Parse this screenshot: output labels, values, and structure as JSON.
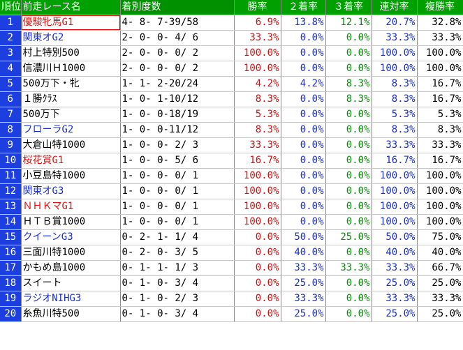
{
  "headers": {
    "rank": "順位",
    "race": "前走レース名",
    "record": "着別度数",
    "win": "勝率",
    "second": "２着率",
    "third": "３着率",
    "rentai": "連対率",
    "fukusho": "複勝率"
  },
  "colors": {
    "header_bg": "#00a000",
    "rank_bg": "#1d3fe0",
    "win_text": "#cc1111",
    "second_text": "#1a2fcc",
    "third_text": "#0a8a0a",
    "g1_text": "#e01010",
    "g2g3_text": "#1a2fcc"
  },
  "rows": [
    {
      "rank": "1",
      "race": "優駿牝馬G1",
      "race_color": "#e01010",
      "boxed": true,
      "record": "4- 8- 7-39/58",
      "win": "6.9%",
      "second": "13.8%",
      "third": "12.1%",
      "rentai": "20.7%",
      "fukusho": "32.8%"
    },
    {
      "rank": "2",
      "race": "関東オG2",
      "race_color": "#1a2fcc",
      "boxed": false,
      "record": "2- 0- 0- 4/ 6",
      "win": "33.3%",
      "second": "0.0%",
      "third": "0.0%",
      "rentai": "33.3%",
      "fukusho": "33.3%"
    },
    {
      "rank": "3",
      "race": "村上特別500",
      "race_color": "#000000",
      "boxed": false,
      "record": "2- 0- 0- 0/ 2",
      "win": "100.0%",
      "second": "0.0%",
      "third": "0.0%",
      "rentai": "100.0%",
      "fukusho": "100.0%"
    },
    {
      "rank": "4",
      "race": "信濃川Ｈ1000",
      "race_color": "#000000",
      "boxed": false,
      "record": "2- 0- 0- 0/ 2",
      "win": "100.0%",
      "second": "0.0%",
      "third": "0.0%",
      "rentai": "100.0%",
      "fukusho": "100.0%"
    },
    {
      "rank": "5",
      "race": "500万下・牝",
      "race_color": "#000000",
      "boxed": false,
      "record": "1- 1- 2-20/24",
      "win": "4.2%",
      "second": "4.2%",
      "third": "8.3%",
      "rentai": "8.3%",
      "fukusho": "16.7%"
    },
    {
      "rank": "6",
      "race": "１勝ｸﾗｽ",
      "race_color": "#000000",
      "boxed": false,
      "record": "1- 0- 1-10/12",
      "win": "8.3%",
      "second": "0.0%",
      "third": "8.3%",
      "rentai": "8.3%",
      "fukusho": "16.7%"
    },
    {
      "rank": "7",
      "race": "500万下",
      "race_color": "#000000",
      "boxed": false,
      "record": "1- 0- 0-18/19",
      "win": "5.3%",
      "second": "0.0%",
      "third": "0.0%",
      "rentai": "5.3%",
      "fukusho": "5.3%"
    },
    {
      "rank": "8",
      "race": "フローラG2",
      "race_color": "#1a2fcc",
      "boxed": false,
      "record": "1- 0- 0-11/12",
      "win": "8.3%",
      "second": "0.0%",
      "third": "0.0%",
      "rentai": "8.3%",
      "fukusho": "8.3%"
    },
    {
      "rank": "9",
      "race": "大倉山特1000",
      "race_color": "#000000",
      "boxed": false,
      "record": "1- 0- 0- 2/ 3",
      "win": "33.3%",
      "second": "0.0%",
      "third": "0.0%",
      "rentai": "33.3%",
      "fukusho": "33.3%"
    },
    {
      "rank": "10",
      "race": "桜花賞G1",
      "race_color": "#e01010",
      "boxed": false,
      "record": "1- 0- 0- 5/ 6",
      "win": "16.7%",
      "second": "0.0%",
      "third": "0.0%",
      "rentai": "16.7%",
      "fukusho": "16.7%"
    },
    {
      "rank": "11",
      "race": "小豆島特1000",
      "race_color": "#000000",
      "boxed": false,
      "record": "1- 0- 0- 0/ 1",
      "win": "100.0%",
      "second": "0.0%",
      "third": "0.0%",
      "rentai": "100.0%",
      "fukusho": "100.0%"
    },
    {
      "rank": "12",
      "race": "関東オG3",
      "race_color": "#1a2fcc",
      "boxed": false,
      "record": "1- 0- 0- 0/ 1",
      "win": "100.0%",
      "second": "0.0%",
      "third": "0.0%",
      "rentai": "100.0%",
      "fukusho": "100.0%"
    },
    {
      "rank": "13",
      "race": "ＮＨＫマG1",
      "race_color": "#e01010",
      "boxed": false,
      "record": "1- 0- 0- 0/ 1",
      "win": "100.0%",
      "second": "0.0%",
      "third": "0.0%",
      "rentai": "100.0%",
      "fukusho": "100.0%"
    },
    {
      "rank": "14",
      "race": "ＨＴＢ賞1000",
      "race_color": "#000000",
      "boxed": false,
      "record": "1- 0- 0- 0/ 1",
      "win": "100.0%",
      "second": "0.0%",
      "third": "0.0%",
      "rentai": "100.0%",
      "fukusho": "100.0%"
    },
    {
      "rank": "15",
      "race": "クイーンG3",
      "race_color": "#1a2fcc",
      "boxed": false,
      "record": "0- 2- 1- 1/ 4",
      "win": "0.0%",
      "second": "50.0%",
      "third": "25.0%",
      "rentai": "50.0%",
      "fukusho": "75.0%"
    },
    {
      "rank": "16",
      "race": "三面川特1000",
      "race_color": "#000000",
      "boxed": false,
      "record": "0- 2- 0- 3/ 5",
      "win": "0.0%",
      "second": "40.0%",
      "third": "0.0%",
      "rentai": "40.0%",
      "fukusho": "40.0%"
    },
    {
      "rank": "17",
      "race": "かもめ島1000",
      "race_color": "#000000",
      "boxed": false,
      "record": "0- 1- 1- 1/ 3",
      "win": "0.0%",
      "second": "33.3%",
      "third": "33.3%",
      "rentai": "33.3%",
      "fukusho": "66.7%"
    },
    {
      "rank": "18",
      "race": "スイート",
      "race_color": "#000000",
      "boxed": false,
      "record": "0- 1- 0- 3/ 4",
      "win": "0.0%",
      "second": "25.0%",
      "third": "0.0%",
      "rentai": "25.0%",
      "fukusho": "25.0%"
    },
    {
      "rank": "19",
      "race": "ラジオNIHG3",
      "race_color": "#1a2fcc",
      "boxed": false,
      "record": "0- 1- 0- 2/ 3",
      "win": "0.0%",
      "second": "33.3%",
      "third": "0.0%",
      "rentai": "33.3%",
      "fukusho": "33.3%"
    },
    {
      "rank": "20",
      "race": "糸魚川特500",
      "race_color": "#000000",
      "boxed": false,
      "record": "0- 1- 0- 3/ 4",
      "win": "0.0%",
      "second": "25.0%",
      "third": "0.0%",
      "rentai": "25.0%",
      "fukusho": "25.0%"
    }
  ]
}
